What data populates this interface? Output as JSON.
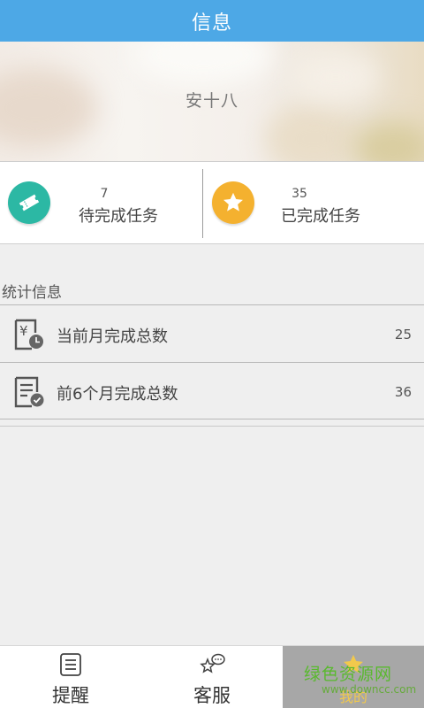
{
  "header": {
    "title": "信息"
  },
  "banner": {
    "name": "安十八"
  },
  "tasks": {
    "pending": {
      "count": "7",
      "label": "待完成任务",
      "icon": "ticket-icon",
      "color": "#2cb8a4"
    },
    "completed": {
      "count": "35",
      "label": "已完成任务",
      "icon": "star-icon",
      "color": "#f4b12f"
    }
  },
  "stats": {
    "title": "统计信息",
    "rows": [
      {
        "label": "当前月完成总数",
        "value": "25",
        "icon": "yen-clock-icon"
      },
      {
        "label": "前6个月完成总数",
        "value": "36",
        "icon": "document-check-icon"
      }
    ]
  },
  "tabbar": {
    "tabs": [
      {
        "label": "提醒",
        "icon": "list-icon"
      },
      {
        "label": "客服",
        "icon": "chat-star-icon"
      },
      {
        "label": "我的",
        "icon": "star-icon",
        "active": true
      }
    ]
  },
  "watermark": {
    "title": "绿色资源网",
    "url": "www.downcc.com"
  },
  "colors": {
    "header": "#4da8e6",
    "accent_teal": "#2cb8a4",
    "accent_yellow": "#f4b12f"
  }
}
